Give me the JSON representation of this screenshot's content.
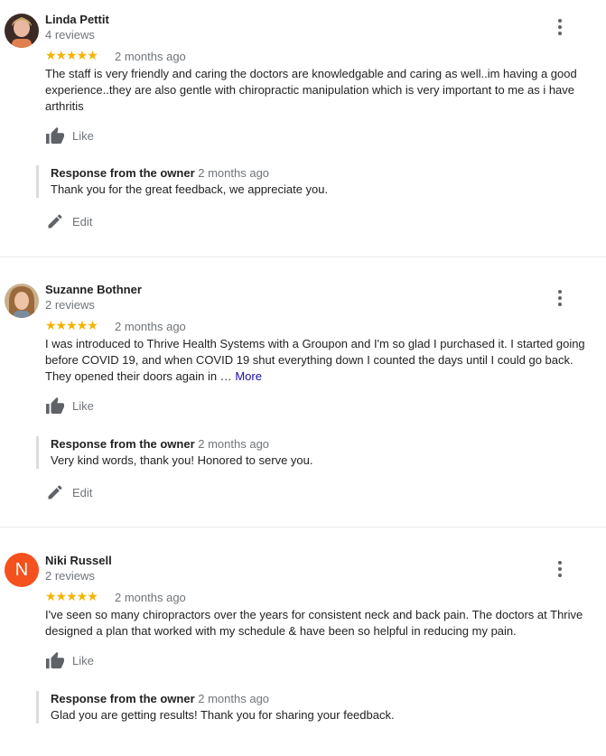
{
  "reviews": [
    {
      "name": "Linda Pettit",
      "count": "4 reviews",
      "stars": "★★★★★",
      "date": "2 months ago",
      "text": "The staff is very friendly and caring the doctors are knowledgable and caring as well..im having a good experience..they are also gentle with chiropractic manipulation which is very important to me as i have arthritis",
      "more": "",
      "like": "Like",
      "response_title": "Response from the owner",
      "response_date": "2 months ago",
      "response_text": "Thank you for the great feedback, we appreciate you.",
      "edit": "Edit"
    },
    {
      "name": "Suzanne Bothner",
      "count": "2 reviews",
      "stars": "★★★★★",
      "date": "2 months ago",
      "text": "I was introduced to Thrive Health Systems with a Groupon and I'm so glad I purchased it.  I started going before COVID 19, and when COVID 19 shut everything down I counted the days until I could go back. They opened their doors again in …",
      "more": "More",
      "like": "Like",
      "response_title": "Response from the owner",
      "response_date": "2 months ago",
      "response_text": "Very kind words, thank you! Honored to serve you.",
      "edit": "Edit"
    },
    {
      "name": "Niki Russell",
      "count": "2 reviews",
      "avatar_letter": "N",
      "stars": "★★★★★",
      "date": "2 months ago",
      "text": "I've seen so many chiropractors over the years for consistent neck and back pain. The doctors at Thrive designed a plan that worked with my schedule & have been so helpful in reducing my pain.",
      "more": "",
      "like": "Like",
      "response_title": "Response from the owner",
      "response_date": "2 months ago",
      "response_text": "Glad you are getting results! Thank you for sharing your feedback."
    }
  ],
  "colors": {
    "star": "#f4b400",
    "letter_avatar": "#f4511e",
    "link": "#1a0dab",
    "muted": "#70757a"
  },
  "icons": [
    "more-vert-icon",
    "thumb-up-icon",
    "pencil-icon"
  ]
}
